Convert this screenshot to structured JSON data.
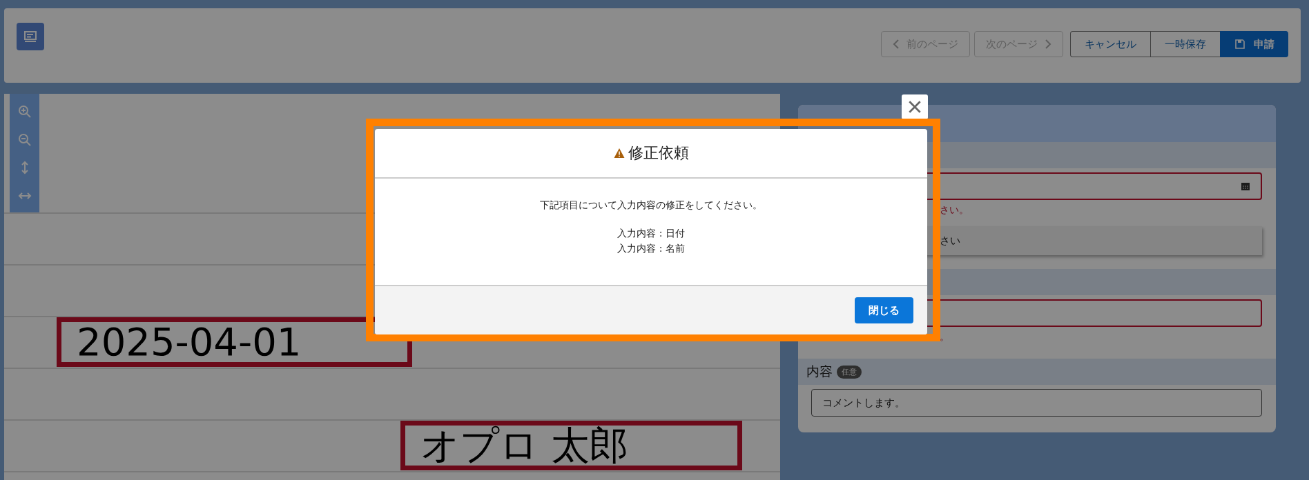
{
  "header": {
    "nav_buttons": [
      {
        "label": "前のページ",
        "disabled": true
      },
      {
        "label": "次のページ",
        "disabled": true
      }
    ],
    "actions": [
      {
        "label": "キャンセル",
        "kind": "secondary"
      },
      {
        "label": "一時保存",
        "kind": "secondary"
      },
      {
        "label": "申請",
        "kind": "primary"
      }
    ]
  },
  "document": {
    "fields": [
      {
        "value": "2025-04-01",
        "error": true
      },
      {
        "value": "オプロ 太郎",
        "error": true
      }
    ]
  },
  "panel": {
    "sections": [
      {
        "kind": "date",
        "error": true,
        "error_text": "さい。",
        "tooltip": "さい"
      },
      {
        "kind": "text",
        "error": true,
        "error_text": "。"
      },
      {
        "kind": "text",
        "label": "内容",
        "badge": "任意",
        "value": "コメントします。",
        "error": false
      }
    ]
  },
  "dialog": {
    "title": "修正依頼",
    "message": "下記項目について入力内容の修正をしてください。",
    "items": [
      "入力内容 : 日付",
      "入力内容 : 名前"
    ],
    "button": "閉じる"
  }
}
